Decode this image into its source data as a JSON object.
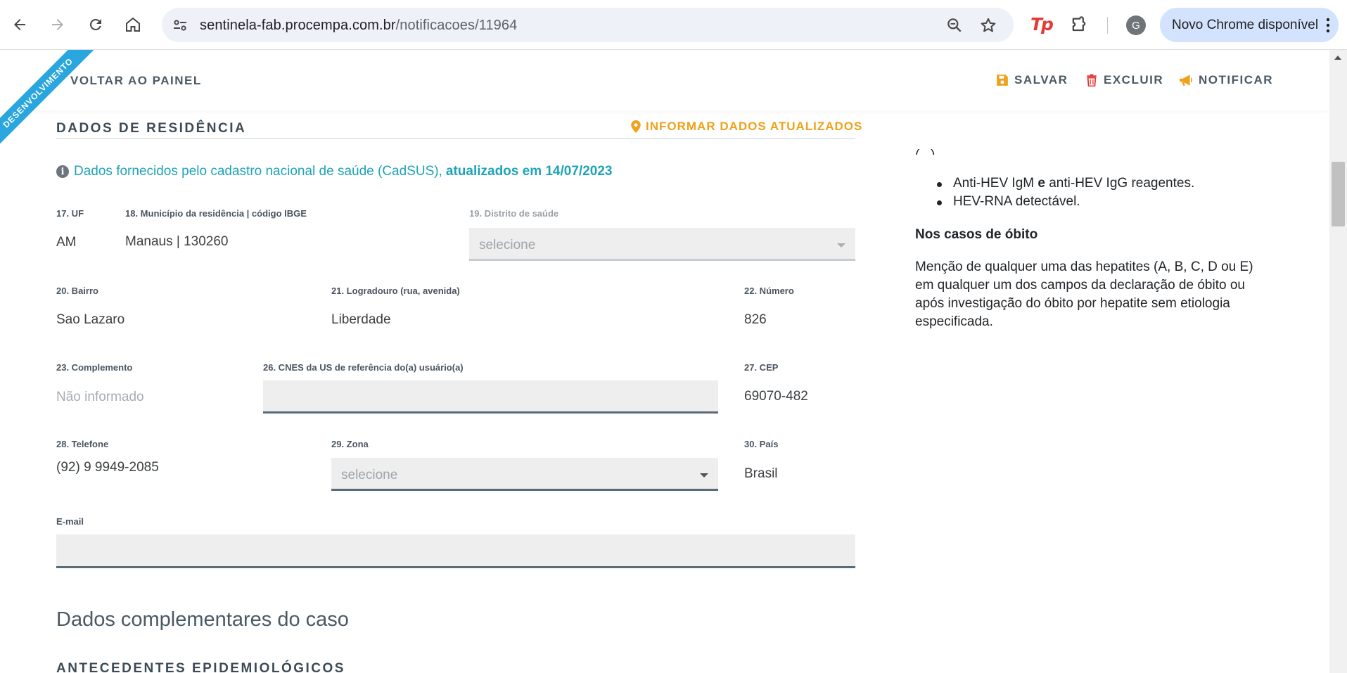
{
  "browser": {
    "url_host": "sentinela-fab.procempa.com.br",
    "url_path": "/notificacoes/11964",
    "ext_label": "Tp",
    "profile_initial": "G",
    "update_label": "Novo Chrome disponível"
  },
  "header": {
    "back_label": "VOLTAR AO PAINEL",
    "save_label": "SALVAR",
    "delete_label": "EXCLUIR",
    "notify_label": "NOTIFICAR",
    "ribbon_label": "DESENVOLVIMENTO"
  },
  "residence": {
    "title": "DADOS DE RESIDÊNCIA",
    "inform_label": "INFORMAR DADOS ATUALIZADOS",
    "info_text": "Dados fornecidos pelo cadastro nacional de saúde (CadSUS),",
    "info_bold": "atualizados em 14/07/2023",
    "uf": {
      "label": "17. UF",
      "value": "AM"
    },
    "municipio": {
      "label": "18. Município da residência | código IBGE",
      "value": "Manaus | 130260"
    },
    "distrito": {
      "label": "19. Distrito de saúde",
      "placeholder": "selecione"
    },
    "bairro": {
      "label": "20. Bairro",
      "value": "Sao Lazaro"
    },
    "logradouro": {
      "label": "21. Logradouro (rua, avenida)",
      "value": "Liberdade"
    },
    "numero": {
      "label": "22. Número",
      "value": "826"
    },
    "complemento": {
      "label": "23. Complemento",
      "value": "Não informado"
    },
    "cnes": {
      "label": "26. CNES da US de referência do(a) usuário(a)",
      "value": ""
    },
    "cep": {
      "label": "27. CEP",
      "value": "69070-482"
    },
    "telefone": {
      "label": "28. Telefone",
      "value": "(92) 9 9949-2085"
    },
    "zona": {
      "label": "29. Zona",
      "placeholder": "selecione"
    },
    "pais": {
      "label": "30. País",
      "value": "Brasil"
    },
    "email": {
      "label": "E-mail",
      "value": ""
    }
  },
  "complementary": {
    "heading": "Dados complementares do caso",
    "section": "ANTECEDENTES EPIDEMIOLÓGICOS"
  },
  "sidebar_info": {
    "bullets": [
      {
        "pre": "Anti-HEV IgM ",
        "bold": "e",
        "post": " anti-HEV IgG reagentes."
      },
      {
        "pre": "HEV-RNA detectável.",
        "bold": "",
        "post": ""
      }
    ],
    "heading": "Nos casos de óbito",
    "paragraph": "Menção de qualquer uma das hepatites (A, B, C, D ou E) em qualquer um dos campos da declaração de óbito ou após investigação do óbito por hepatite sem etiologia especificada."
  },
  "colors": {
    "accent_teal": "#1ea3b8",
    "accent_orange": "#f0a11c",
    "delete_red": "#e53935",
    "ribbon_blue": "#29a6dd",
    "text_dark": "#3d4a55"
  }
}
